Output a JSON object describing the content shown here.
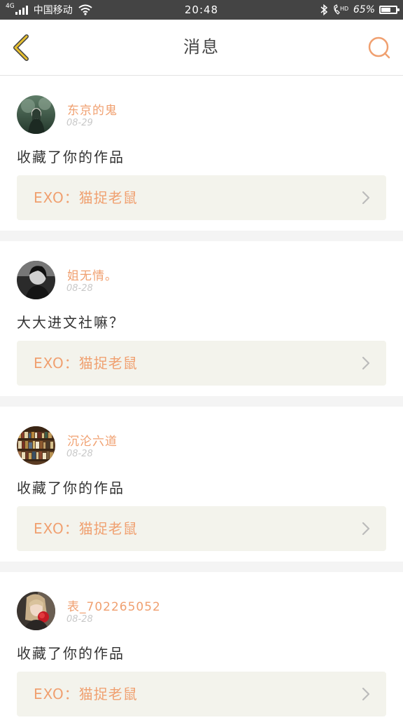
{
  "status_bar": {
    "network_type": "4G",
    "carrier": "中国移动",
    "time": "20:48",
    "battery_percent_text": "65%",
    "battery_level": 0.65
  },
  "nav": {
    "title": "消息",
    "back_icon": "chevron-left-icon",
    "search_icon": "search-icon",
    "accent_color": "#f0a070",
    "back_color": "#e8c030"
  },
  "messages": [
    {
      "user": "东京的鬼",
      "date": "08-29",
      "content": "收藏了你的作品",
      "work_title": "EXO：猫捉老鼠",
      "avatar": "avatar-forest"
    },
    {
      "user": "姐无情。",
      "date": "08-28",
      "content": "大大进文社嘛？",
      "work_title": "EXO：猫捉老鼠",
      "avatar": "avatar-dark-portrait"
    },
    {
      "user": "沉沦六道",
      "date": "08-28",
      "content": "收藏了你的作品",
      "work_title": "EXO：猫捉老鼠",
      "avatar": "avatar-bookshelf"
    },
    {
      "user": "表_702265052",
      "date": "08-28",
      "content": "收藏了你的作品",
      "work_title": "EXO：猫捉老鼠",
      "avatar": "avatar-rose-girl"
    }
  ]
}
